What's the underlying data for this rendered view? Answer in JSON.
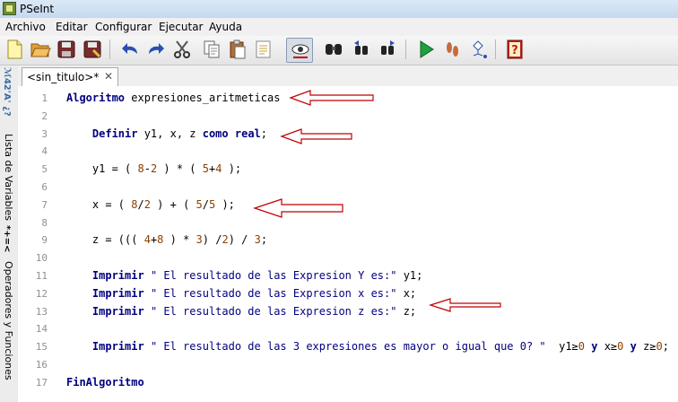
{
  "window": {
    "title": "PSeInt"
  },
  "menu": [
    "Archivo",
    "Editar",
    "Configurar",
    "Ejecutar",
    "Ayuda"
  ],
  "sidebar": {
    "glyphs_top": "ℳ42'A' ¿?",
    "variables_label": "Lista de Variables",
    "glyphs_mid": "*+=<",
    "operators_label": "Operadores y Funciones"
  },
  "tab": {
    "label": "<sin_titulo>*",
    "close": "✕"
  },
  "lines": [
    {
      "n": "1",
      "parts": [
        {
          "t": "Algoritmo",
          "c": "kw"
        },
        {
          "t": " expresiones_aritmeticas",
          "c": ""
        }
      ]
    },
    {
      "n": "2",
      "parts": []
    },
    {
      "n": "3",
      "parts": [
        {
          "t": "    ",
          "c": ""
        },
        {
          "t": "Definir",
          "c": "kw"
        },
        {
          "t": " y1, x, z ",
          "c": ""
        },
        {
          "t": "como",
          "c": "kw"
        },
        {
          "t": " ",
          "c": ""
        },
        {
          "t": "real",
          "c": "kw"
        },
        {
          "t": ";",
          "c": ""
        }
      ]
    },
    {
      "n": "4",
      "parts": []
    },
    {
      "n": "5",
      "parts": [
        {
          "t": "    y1 = ( ",
          "c": ""
        },
        {
          "t": "8",
          "c": "nm"
        },
        {
          "t": "-",
          "c": ""
        },
        {
          "t": "2",
          "c": "nm"
        },
        {
          "t": " ) * ( ",
          "c": ""
        },
        {
          "t": "5",
          "c": "nm"
        },
        {
          "t": "+",
          "c": ""
        },
        {
          "t": "4",
          "c": "nm"
        },
        {
          "t": " );",
          "c": ""
        }
      ]
    },
    {
      "n": "6",
      "parts": []
    },
    {
      "n": "7",
      "parts": [
        {
          "t": "    x = ( ",
          "c": ""
        },
        {
          "t": "8",
          "c": "nm"
        },
        {
          "t": "/",
          "c": ""
        },
        {
          "t": "2",
          "c": "nm"
        },
        {
          "t": " ) + ( ",
          "c": ""
        },
        {
          "t": "5",
          "c": "nm"
        },
        {
          "t": "/",
          "c": ""
        },
        {
          "t": "5",
          "c": "nm"
        },
        {
          "t": " );",
          "c": ""
        }
      ]
    },
    {
      "n": "8",
      "parts": []
    },
    {
      "n": "9",
      "parts": [
        {
          "t": "    z = ((( ",
          "c": ""
        },
        {
          "t": "4",
          "c": "nm"
        },
        {
          "t": "+",
          "c": ""
        },
        {
          "t": "8",
          "c": "nm"
        },
        {
          "t": " ) * ",
          "c": ""
        },
        {
          "t": "3",
          "c": "nm"
        },
        {
          "t": ") /",
          "c": ""
        },
        {
          "t": "2",
          "c": "nm"
        },
        {
          "t": ") / ",
          "c": ""
        },
        {
          "t": "3",
          "c": "nm"
        },
        {
          "t": ";",
          "c": ""
        }
      ]
    },
    {
      "n": "10",
      "parts": []
    },
    {
      "n": "11",
      "parts": [
        {
          "t": "    ",
          "c": ""
        },
        {
          "t": "Imprimir",
          "c": "kw"
        },
        {
          "t": " ",
          "c": ""
        },
        {
          "t": "\" El resultado de las Expresion Y es:\"",
          "c": "st"
        },
        {
          "t": " y1;",
          "c": ""
        }
      ]
    },
    {
      "n": "12",
      "parts": [
        {
          "t": "    ",
          "c": ""
        },
        {
          "t": "Imprimir",
          "c": "kw"
        },
        {
          "t": " ",
          "c": ""
        },
        {
          "t": "\" El resultado de las Expresion x es:\"",
          "c": "st"
        },
        {
          "t": " x;",
          "c": ""
        }
      ]
    },
    {
      "n": "13",
      "parts": [
        {
          "t": "    ",
          "c": ""
        },
        {
          "t": "Imprimir",
          "c": "kw"
        },
        {
          "t": " ",
          "c": ""
        },
        {
          "t": "\" El resultado de las Expresion z es:\"",
          "c": "st"
        },
        {
          "t": " z;",
          "c": ""
        }
      ]
    },
    {
      "n": "14",
      "parts": []
    },
    {
      "n": "15",
      "parts": [
        {
          "t": "    ",
          "c": ""
        },
        {
          "t": "Imprimir",
          "c": "kw"
        },
        {
          "t": " ",
          "c": ""
        },
        {
          "t": "\" El resultado de las 3 expresiones es mayor o igual que 0? \"",
          "c": "st"
        },
        {
          "t": "  y1≥",
          "c": ""
        },
        {
          "t": "0",
          "c": "nm"
        },
        {
          "t": " ",
          "c": ""
        },
        {
          "t": "y",
          "c": "kw"
        },
        {
          "t": " x≥",
          "c": ""
        },
        {
          "t": "0",
          "c": "nm"
        },
        {
          "t": " ",
          "c": ""
        },
        {
          "t": "y",
          "c": "kw"
        },
        {
          "t": " z≥",
          "c": ""
        },
        {
          "t": "0",
          "c": "nm"
        },
        {
          "t": ";",
          "c": ""
        }
      ]
    },
    {
      "n": "16",
      "parts": []
    },
    {
      "n": "17",
      "parts": [
        {
          "t": "FinAlgoritmo",
          "c": "kw"
        }
      ]
    }
  ],
  "colors": {
    "keyword": "#000080",
    "number": "#8b4000",
    "annotation": "#c00000"
  }
}
